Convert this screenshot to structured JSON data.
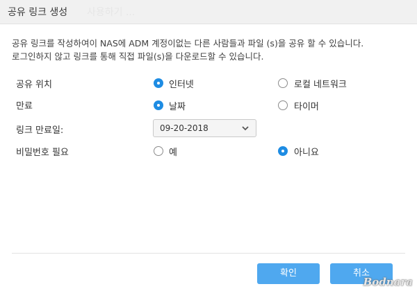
{
  "dialog": {
    "title": "공유 링크 생성",
    "ghost_text": "사용하기 ..."
  },
  "description": {
    "line1": "공유 링크를 작성하여이 NAS에 ADM 계정이없는 다른 사람들과 파일 (s)을 공유 할 수 있습니다.",
    "line2": "로그인하지 않고 링크를 통해 직접 파일(s)을 다운로드할 수 있습니다."
  },
  "share_location": {
    "label": "공유 위치",
    "options": [
      {
        "label": "인터넷",
        "selected": true
      },
      {
        "label": "로컬 네트워크",
        "selected": false
      }
    ]
  },
  "expiration": {
    "label": "만료",
    "options": [
      {
        "label": "날짜",
        "selected": true
      },
      {
        "label": "타이머",
        "selected": false
      }
    ]
  },
  "link_expiry_date": {
    "label": "링크 만료일:",
    "value": "09-20-2018"
  },
  "password_required": {
    "label": "비밀번호 필요",
    "options": [
      {
        "label": "예",
        "selected": false
      },
      {
        "label": "아니요",
        "selected": true
      }
    ]
  },
  "buttons": {
    "confirm": "확인",
    "cancel": "취소"
  },
  "watermark": "Bodnara",
  "colors": {
    "accent": "#1e8ce3",
    "button": "#4fa8ef",
    "titlebar": "#f1f1f1"
  },
  "icons": {
    "select_arrow": "chevron-down-icon"
  }
}
